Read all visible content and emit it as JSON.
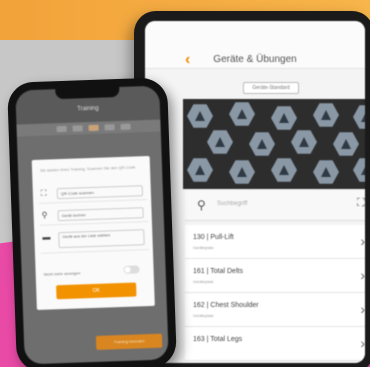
{
  "tablet": {
    "back_icon": "chevron-left-icon",
    "title": "Geräte & Übungen",
    "filter_label": "Geräte-Standard",
    "search": {
      "icon": "search-icon",
      "placeholder": "Suchbegriff",
      "expand_icon": "expand-icon"
    },
    "rows": [
      {
        "title": "130 | Pull-Lift",
        "subtitle": "Geräteplatz"
      },
      {
        "title": "161 | Total Delts",
        "subtitle": "Geräteplatz"
      },
      {
        "title": "162 | Chest Shoulder",
        "subtitle": "Geräteplatz"
      },
      {
        "title": "163 | Total Legs",
        "subtitle": ""
      }
    ]
  },
  "phone": {
    "title": "Training",
    "dialog": {
      "text": "Sie starten Ihren Training. Scannen Sie den QR-Code",
      "rows": [
        {
          "icon": "scan-icon",
          "value": "QR-Code scannen"
        },
        {
          "icon": "search-icon",
          "value": "Gerät suchen"
        },
        {
          "icon": "dumbbell-icon",
          "value": "Gerät aus der Liste wählen"
        }
      ],
      "toggle_label": "Nicht mehr anzeigen",
      "ok_label": "OK"
    },
    "bottom_button": "Training beenden"
  },
  "colors": {
    "accent": "#f29200",
    "pink": "#e94aa6",
    "background": "#c7c7c7"
  }
}
